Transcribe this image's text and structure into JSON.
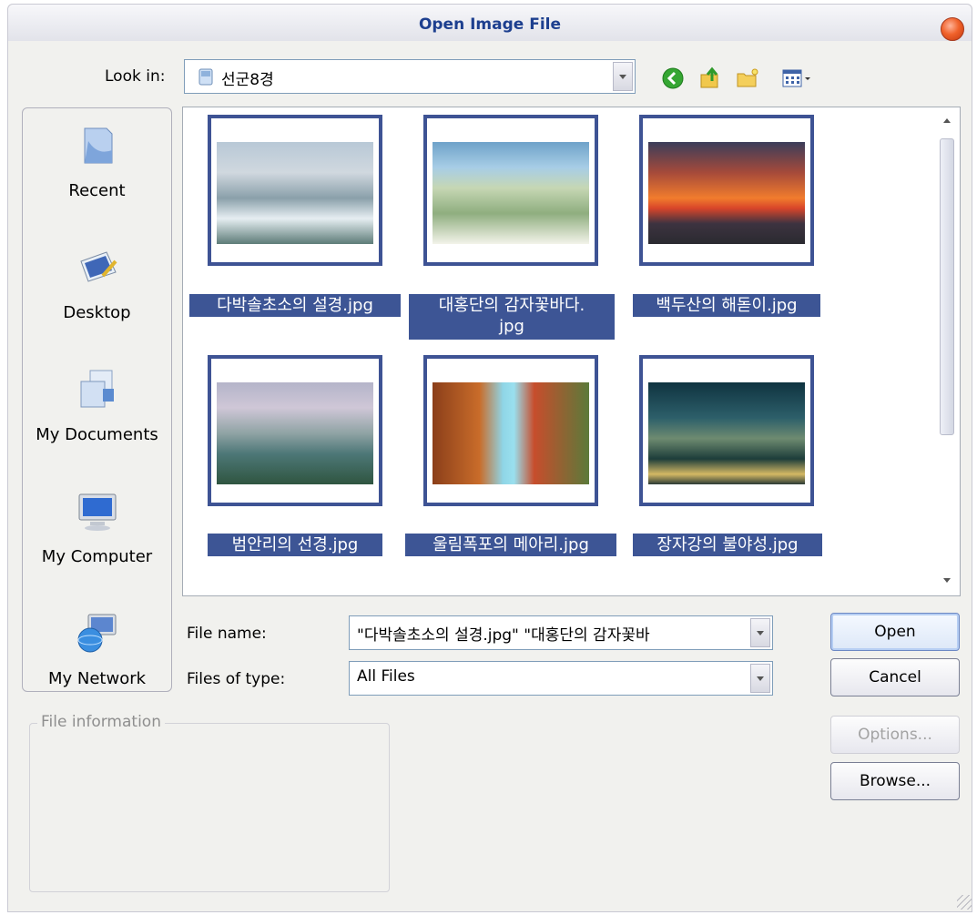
{
  "window": {
    "title": "Open Image File"
  },
  "lookin": {
    "label": "Look in:",
    "value": "선군8경"
  },
  "toolbar": {
    "icons": [
      "back-icon",
      "up-folder-icon",
      "new-folder-icon",
      "view-menu-icon"
    ]
  },
  "places": [
    {
      "label": "Recent",
      "icon": "recent-icon"
    },
    {
      "label": "Desktop",
      "icon": "desktop-icon"
    },
    {
      "label": "My Documents",
      "icon": "documents-icon"
    },
    {
      "label": "My Computer",
      "icon": "computer-icon"
    },
    {
      "label": "My Network",
      "icon": "network-icon"
    }
  ],
  "files": [
    {
      "name": "다박솔초소의 설경.jpg"
    },
    {
      "name": "대홍단의 감자꽃바다.",
      "name2": "jpg"
    },
    {
      "name": "백두산의 해돋이.jpg"
    },
    {
      "name": "범안리의 선경.jpg"
    },
    {
      "name": "울림폭포의 메아리.jpg"
    },
    {
      "name": "장자강의 불야성.jpg"
    }
  ],
  "filename": {
    "label": "File name:",
    "value": "\"다박솔초소의 설경.jpg\" \"대홍단의 감자꽃바"
  },
  "filetype": {
    "label": "Files of type:",
    "value": "All Files"
  },
  "buttons": {
    "open": "Open",
    "cancel": "Cancel",
    "options": "Options...",
    "browse": "Browse..."
  },
  "fileinfo": {
    "legend": "File information"
  },
  "colors": {
    "selection": "#3d5595",
    "title": "#1d3f8f"
  }
}
